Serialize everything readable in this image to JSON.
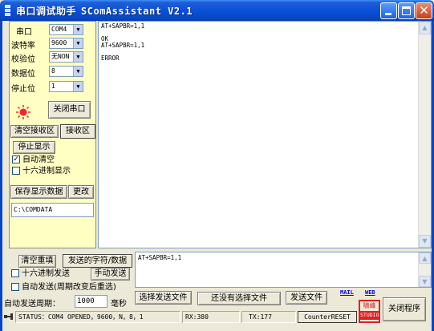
{
  "window": {
    "title_cn": "串口调试助手",
    "title_en": "SComAssistant V2.1"
  },
  "settings": {
    "port_label": "串口",
    "port_value": "COM4",
    "baud_label": "波特率",
    "baud_value": "9600",
    "parity_label": "校验位",
    "parity_value": "无NON",
    "databits_label": "数据位",
    "databits_value": "8",
    "stopbits_label": "停止位",
    "stopbits_value": "1",
    "close_port_button": "关闭串口"
  },
  "receive_controls": {
    "clear_receive_button": "清空接收区",
    "receive_area_tab": "接收区",
    "stop_display_button": "停止显示",
    "auto_clear_label": "自动清空",
    "auto_clear_checked": true,
    "hex_display_label": "十六进制显示",
    "hex_display_checked": false,
    "save_data_button": "保存显示数据",
    "change_button": "更改",
    "save_path": "C:\\COMDATA"
  },
  "receive_text": "AT+SAPBR=1,1\n\nOK\nAT+SAPBR=1,1\n\nERROR",
  "send_controls": {
    "clear_refill_button": "清空重填",
    "send_chars_button": "发送的字符/数据",
    "hex_send_label": "十六进制发送",
    "hex_send_checked": false,
    "manual_send_button": "手动发送",
    "auto_send_label": "自动发送(周期改变后重选)",
    "auto_send_checked": false,
    "period_label": "自动发送周期：",
    "period_value": "1000",
    "period_unit": "毫秒",
    "send_text": "AT+SAPBR=1,1",
    "select_file_button": "选择发送文件",
    "file_status": "还没有选择文件",
    "send_file_button": "发送文件",
    "mail_link": "MAIL",
    "web_link": "WEB",
    "stamp_top": "啸峰",
    "stamp_bottom": "STUDIO",
    "close_program_button": "关闭程序"
  },
  "status_bar": {
    "status": "STATUS：COM4 OPENED，9600，N，8，1",
    "rx": "RX:380",
    "tx": "TX:177",
    "counter_reset_button": "CounterRESET"
  },
  "colors": {
    "titlebar": "#0a50d8",
    "settings_panel": "#ffffc4",
    "led": "#ff2020",
    "stamp": "#e02020"
  }
}
